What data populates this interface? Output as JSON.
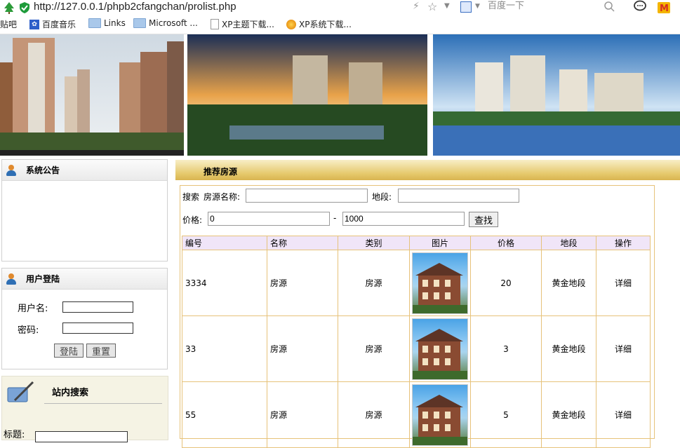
{
  "browser": {
    "url": "http://127.0.0.1/phpb2cfangchan/prolist.php",
    "search_placeholder": "百度一下",
    "bookmarks": [
      "贴吧",
      "百度音乐",
      "Links",
      "Microsoft ...",
      "XP主题下载...",
      "XP系统下载..."
    ]
  },
  "sidebar": {
    "notice_title": "系统公告",
    "login": {
      "title": "用户登陆",
      "username_label": "用户名:",
      "password_label": "密码:",
      "login_button": "登陆",
      "reset_button": "重置"
    },
    "site_search": {
      "title": "站内搜索",
      "field_label": "标题:"
    }
  },
  "main": {
    "section_title": "推荐房源",
    "search": {
      "label": "搜索",
      "name_label": "房源名称:",
      "district_label": "地段:",
      "price_label": "价格:",
      "price_min": "0",
      "price_sep": "-",
      "price_max": "1000",
      "find_button": "查找"
    },
    "table": {
      "headers": [
        "编号",
        "名称",
        "类别",
        "图片",
        "价格",
        "地段",
        "操作"
      ],
      "rows": [
        {
          "id": "3334",
          "name": "房源",
          "category": "房源",
          "price": "20",
          "district": "黄金地段",
          "action": "详细"
        },
        {
          "id": "33",
          "name": "房源",
          "category": "房源",
          "price": "3",
          "district": "黄金地段",
          "action": "详细"
        },
        {
          "id": "55",
          "name": "房源",
          "category": "房源",
          "price": "5",
          "district": "黄金地段",
          "action": "详细"
        }
      ]
    }
  },
  "colors": {
    "table_border": "#e6c27a",
    "header_bg": "#f0e5f8",
    "section_bar": "#e5c86a"
  }
}
